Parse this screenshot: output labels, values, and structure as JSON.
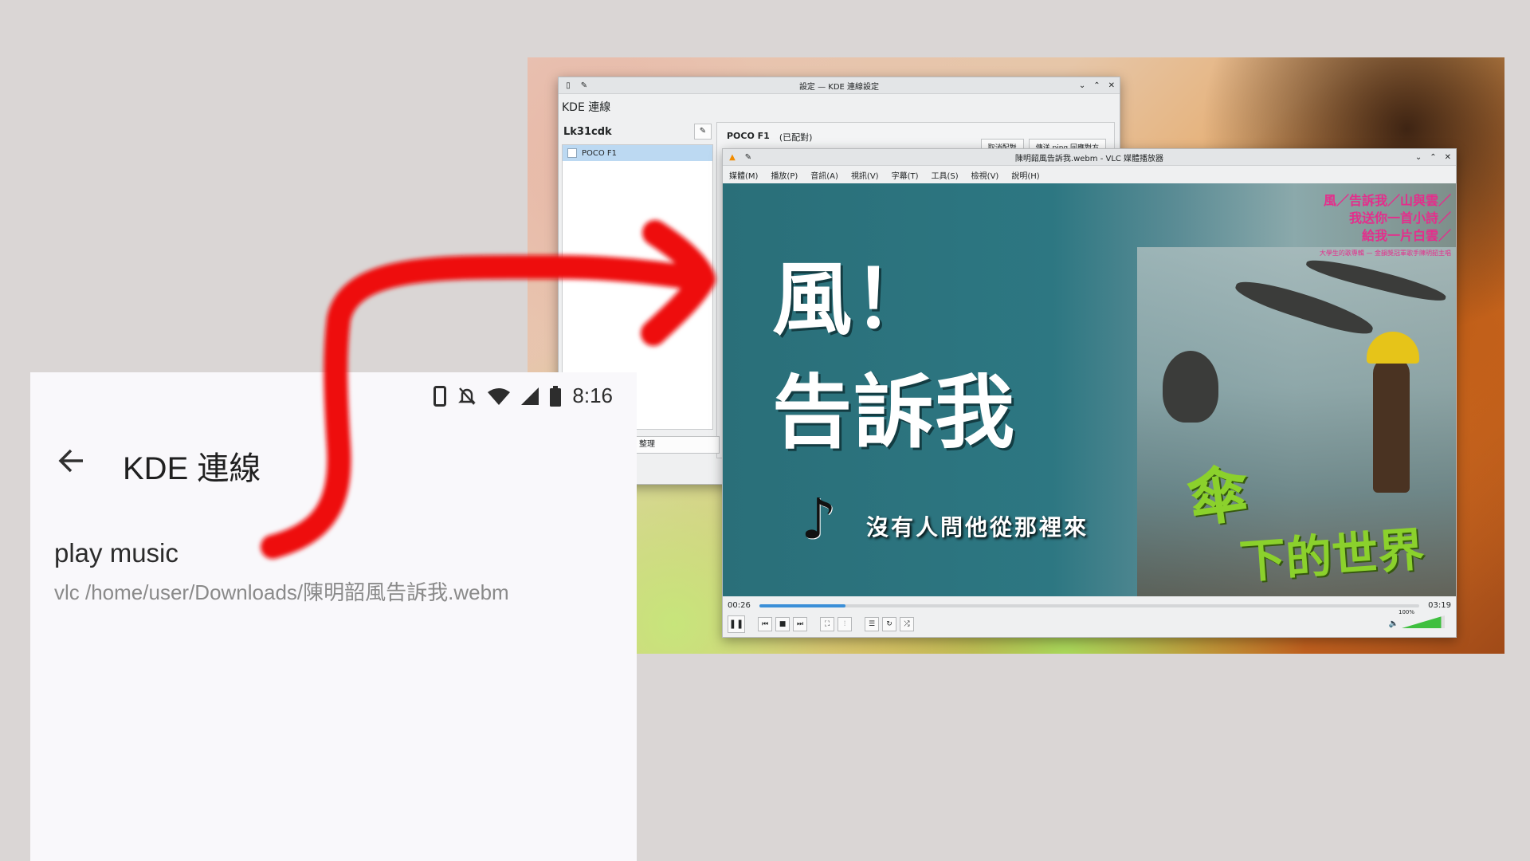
{
  "kde_settings": {
    "title": "設定 — KDE 連線設定",
    "app_label": "KDE 連線",
    "device_name": "Lk31cdk",
    "devices": [
      "POCO F1"
    ],
    "selected_device": "POCO F1",
    "paired_status": "(已配對)",
    "button_unpair": "取消配對",
    "button_ping": "傳送 ping 回應對方",
    "bottom_button": "整理"
  },
  "vlc": {
    "title": "陳明韶風告訴我.webm - VLC 媒體播放器",
    "menu": [
      "媒體(M)",
      "播放(P)",
      "音訊(A)",
      "視訊(V)",
      "字幕(T)",
      "工具(S)",
      "檢視(V)",
      "說明(H)"
    ],
    "video": {
      "title_line1": "風！",
      "title_line2": "告訴我",
      "subtitle": "沒有人問他從那裡來",
      "tag_lines": [
        "風／告訴我／山與雲／",
        "我送你一首小詩／",
        "給我一片白雲／"
      ],
      "tag_small": "大學生的歌專輯 — 金韻獎冠軍歌手陳明韶主唱",
      "logo_line1": "傘",
      "logo_line2": "下的世界"
    },
    "time_elapsed": "00:26",
    "time_total": "03:19",
    "progress": 0.13,
    "volume_label": "100%",
    "volume": 1.0,
    "accent": "#3a8fd8"
  },
  "phone": {
    "time": "8:16",
    "app_title": "KDE 連線",
    "command_name": "play music",
    "command_line": "vlc /home/user/Downloads/陳明韶風告訴我.webm"
  },
  "annotation_color": "#ee1111"
}
